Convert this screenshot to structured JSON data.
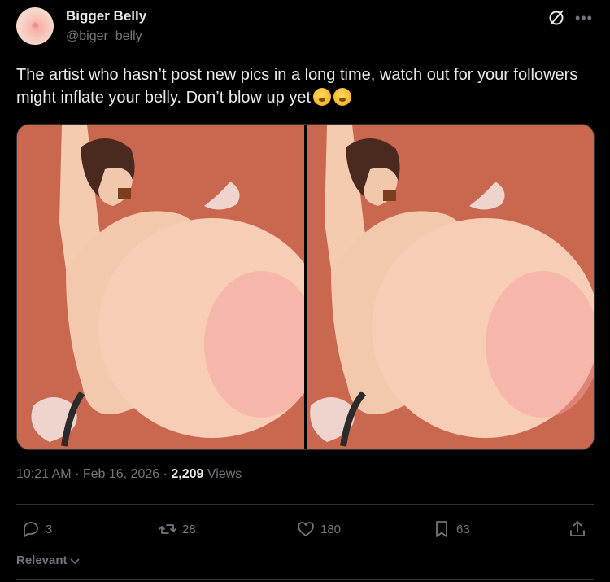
{
  "author": {
    "name": "Bigger Belly",
    "handle": "@biger_belly"
  },
  "tweet": {
    "text": "The artist who hasn’t post new pics in a long time, watch out for your followers might inflate your belly. Don’t blow up yet",
    "emojis": [
      "hand-over-mouth-emoji",
      "hushed-emoji"
    ]
  },
  "media": {
    "images": [
      "illustration-1",
      "illustration-2"
    ]
  },
  "meta": {
    "time": "10:21 AM",
    "date": "Feb 16, 2026",
    "views": "2,209",
    "views_label": "Views"
  },
  "actions": {
    "replies": "3",
    "reposts": "28",
    "likes": "180",
    "bookmarks": "63"
  },
  "sort": {
    "label": "Relevant"
  },
  "colors": {
    "background": "#000000",
    "text": "#e7e9ea",
    "muted": "#71767b",
    "divider": "#2f3336",
    "media_bg": "#c9674f"
  }
}
